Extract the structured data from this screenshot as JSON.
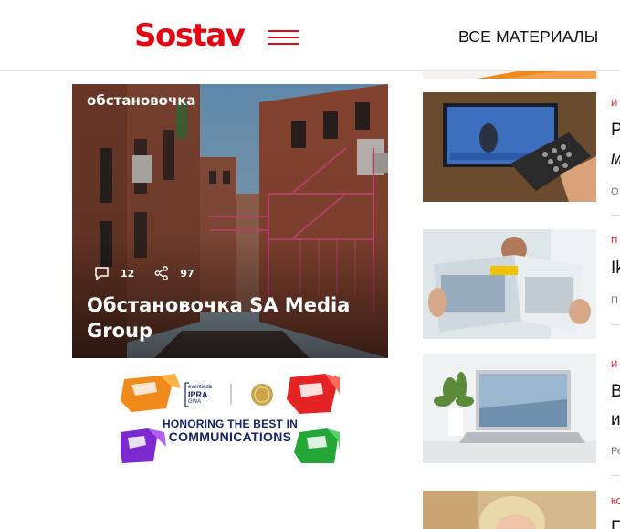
{
  "header": {
    "logo": "Sostav",
    "all_materials": "ВСЕ МАТЕРИАЛЫ",
    "brand_color": "#e30613"
  },
  "feature": {
    "tag": "обстановочка",
    "comments": "12",
    "shares": "97",
    "title": "Обстановочка SA Media Group"
  },
  "banner": {
    "brand_small": "eventiada",
    "brand_big": "IPRA",
    "brand_sub": "GWA",
    "line1": "HONORING THE BEST IN",
    "line2": "COMMUNICATIONS"
  },
  "news": [
    {
      "rubric": "и",
      "title": "Р",
      "subtitle": "м",
      "meta": "О",
      "thumb_icon": "tv-remote-image"
    },
    {
      "rubric": "п",
      "title": "Ik",
      "meta": "П",
      "thumb_icon": "ikea-catalog-image"
    },
    {
      "rubric": "и",
      "title": "В",
      "subtitle": "и",
      "meta": "Ре",
      "thumb_icon": "laptop-image"
    },
    {
      "rubric": "ко",
      "title": "Г",
      "thumb_icon": "woman-portrait-image"
    }
  ]
}
